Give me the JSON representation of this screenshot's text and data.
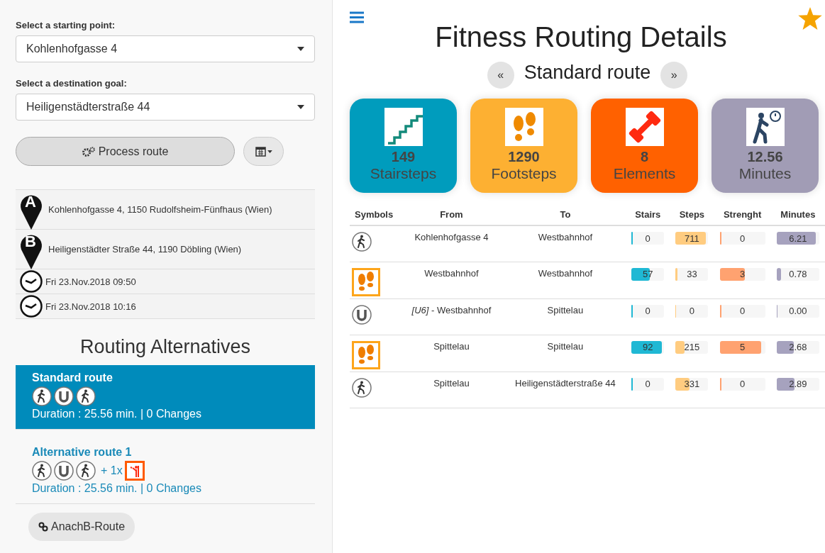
{
  "sidebar": {
    "start": {
      "label": "Select a starting point:",
      "value": "Kohlenhofgasse 4"
    },
    "destination": {
      "label": "Select a destination goal:",
      "value": "Heiligenstädterstraße 44"
    },
    "process_button": "Process route",
    "summary": [
      {
        "kind": "pin",
        "marker": "A",
        "text": "Kohlenhofgasse 4, 1150 Rudolfsheim-Fünfhaus (Wien)"
      },
      {
        "kind": "pin",
        "marker": "B",
        "text": "Heiligenstädter Straße 44, 1190 Döbling (Wien)"
      },
      {
        "kind": "time",
        "text": "Fri 23.Nov.2018 09:50"
      },
      {
        "kind": "time",
        "text": "Fri 23.Nov.2018 10:16"
      }
    ],
    "alternatives_title": "Routing Alternatives",
    "routes": [
      {
        "name": "Standard route",
        "selected": true,
        "symbols": [
          {
            "kind": "walk"
          },
          {
            "kind": "subway"
          },
          {
            "kind": "walk"
          }
        ],
        "duration": "Duration : 25.56 min. | 0 Changes"
      },
      {
        "name": "Alternative route 1",
        "selected": false,
        "symbols": [
          {
            "kind": "walk"
          },
          {
            "kind": "subway"
          },
          {
            "kind": "walk"
          }
        ],
        "extra": "+ 1x",
        "duration": "Duration : 25.56 min. | 0 Changes"
      }
    ],
    "link_button": "AnachB-Route"
  },
  "main": {
    "title": "Fitness Routing Details",
    "prev": "«",
    "route_name": "Standard route",
    "next": "»",
    "tiles": [
      {
        "kind": "stairs",
        "value": "149",
        "label": "Stairsteps",
        "color": "#009cbd"
      },
      {
        "kind": "steps",
        "value": "1290",
        "label": "Footsteps",
        "color": "#fdb032"
      },
      {
        "kind": "strength",
        "value": "8",
        "label": "Elements",
        "color": "#ff6100"
      },
      {
        "kind": "minutes",
        "value": "12.56",
        "label": "Minutes",
        "color": "#a19cb5"
      }
    ],
    "table": {
      "columns": [
        "Symbols",
        "From",
        "To",
        "Stairs",
        "Steps",
        "Strenght",
        "Minutes"
      ],
      "rows": [
        {
          "kind": "walk",
          "from": "Kohlenhofgasse 4",
          "to": "Westbahnhof",
          "stairs": {
            "text": "0",
            "level": 0.03
          },
          "steps": {
            "text": "711",
            "level": 0.92
          },
          "strength": {
            "text": "0",
            "level": 0.03
          },
          "minutes": {
            "text": "6.21",
            "level": 0.92
          }
        },
        {
          "kind": "steps",
          "from": "Westbahnhof",
          "to": "Westbahnhof",
          "stairs": {
            "text": "57",
            "level": 0.57
          },
          "steps": {
            "text": "33",
            "level": 0.05
          },
          "strength": {
            "text": "3",
            "level": 0.55
          },
          "minutes": {
            "text": "0.78",
            "level": 0.11
          }
        },
        {
          "kind": "subway",
          "from": "*[U6]* - Westbahnhof",
          "to": "Spittelau",
          "stairs": {
            "text": "0",
            "level": 0.03
          },
          "steps": {
            "text": "0",
            "level": 0.02
          },
          "strength": {
            "text": "0",
            "level": 0.03
          },
          "minutes": {
            "text": "0.00",
            "level": 0.02
          }
        },
        {
          "kind": "steps",
          "from": "Spittelau",
          "to": "Spittelau",
          "stairs": {
            "text": "92",
            "level": 0.92
          },
          "steps": {
            "text": "215",
            "level": 0.28
          },
          "strength": {
            "text": "5",
            "level": 0.92
          },
          "minutes": {
            "text": "2.68",
            "level": 0.4
          }
        },
        {
          "kind": "walk",
          "from": "Spittelau",
          "to": "Heiligenstädterstraße 44",
          "stairs": {
            "text": "0",
            "level": 0.03
          },
          "steps": {
            "text": "331",
            "level": 0.43
          },
          "strength": {
            "text": "0",
            "level": 0.03
          },
          "minutes": {
            "text": "2.89",
            "level": 0.42
          }
        }
      ]
    }
  }
}
